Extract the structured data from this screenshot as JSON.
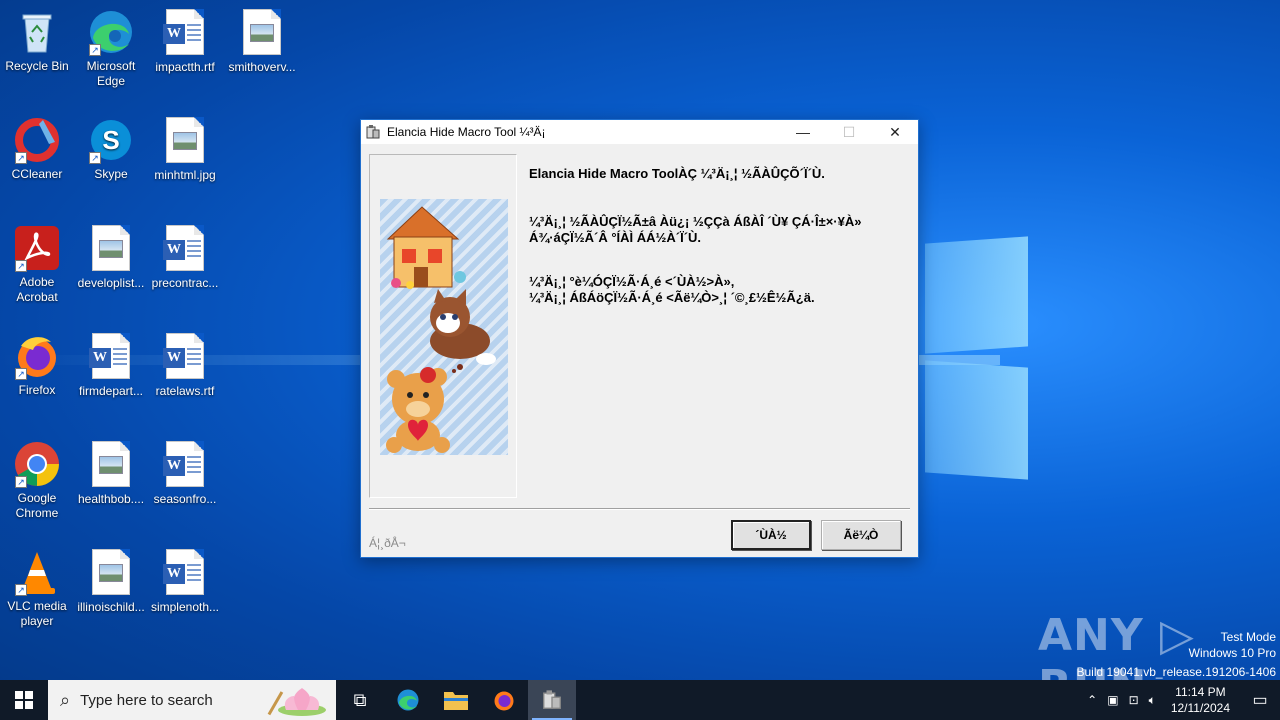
{
  "desktop": {
    "icons": [
      {
        "label": "Recycle Bin"
      },
      {
        "label": "Microsoft Edge"
      },
      {
        "label": "impactth.rtf"
      },
      {
        "label": "smithoverv..."
      },
      {
        "label": "CCleaner"
      },
      {
        "label": "Skype"
      },
      {
        "label": "minhtml.jpg"
      },
      {
        "label": "Adobe Acrobat"
      },
      {
        "label": "developlist..."
      },
      {
        "label": "precontrac..."
      },
      {
        "label": "Firefox"
      },
      {
        "label": "firmdepart..."
      },
      {
        "label": "ratelaws.rtf"
      },
      {
        "label": "Google Chrome"
      },
      {
        "label": "healthbob...."
      },
      {
        "label": "seasonfro..."
      },
      {
        "label": "VLC media player"
      },
      {
        "label": "illinoischild..."
      },
      {
        "label": "simplenoth..."
      }
    ]
  },
  "dialog": {
    "title": "Elancia Hide Macro Tool ¼³Ä¡",
    "message1": "Elancia Hide Macro ToolÀÇ ¼³Ä¡¸¦ ½ÃÀÛÇÕ´Ï´Ù.",
    "message2": "¼³Ä¡¸¦ ½ÃÀÛÇÏ½Ã±â Àü¿¡ ½ÇÇà ÁßÀÎ ´Ù¥ ÇÁ·Î±×·¥À»\nÁ¾·áÇÏ½Ã´Â °ÍÀÌ ÁÁ½À´Ï´Ù.",
    "message3": "¼³Ä¡¸¦ °è¼ÓÇÏ½Ã·Á¸é <´ÙÀ½>À»,\n¼³Ä¡¸¦ ÁßÁöÇÏ½Ã·Á¸é <Ãë¼Ò>¸¦ ´©¸£½Ê½Ã¿ä.",
    "footer_label": "Á¦¸ðÅ¬",
    "next_button": "´ÙÀ½",
    "cancel_button": "Ãë¼Ò",
    "controls": {
      "minimize": "—",
      "maximize": "☐",
      "close": "✕"
    }
  },
  "watermark": {
    "brand": "ANY ▷ RUN",
    "mode": "Test Mode",
    "edition": "Windows 10 Pro",
    "build": "Build 19041.vb_release.191206-1406"
  },
  "taskbar": {
    "search_placeholder": "Type here to search",
    "time": "11:14 PM",
    "date": "12/11/2024"
  },
  "colors": {
    "accent": "#1f6fcf",
    "taskbar": "#101a28",
    "desktop": "#0a63d6"
  }
}
